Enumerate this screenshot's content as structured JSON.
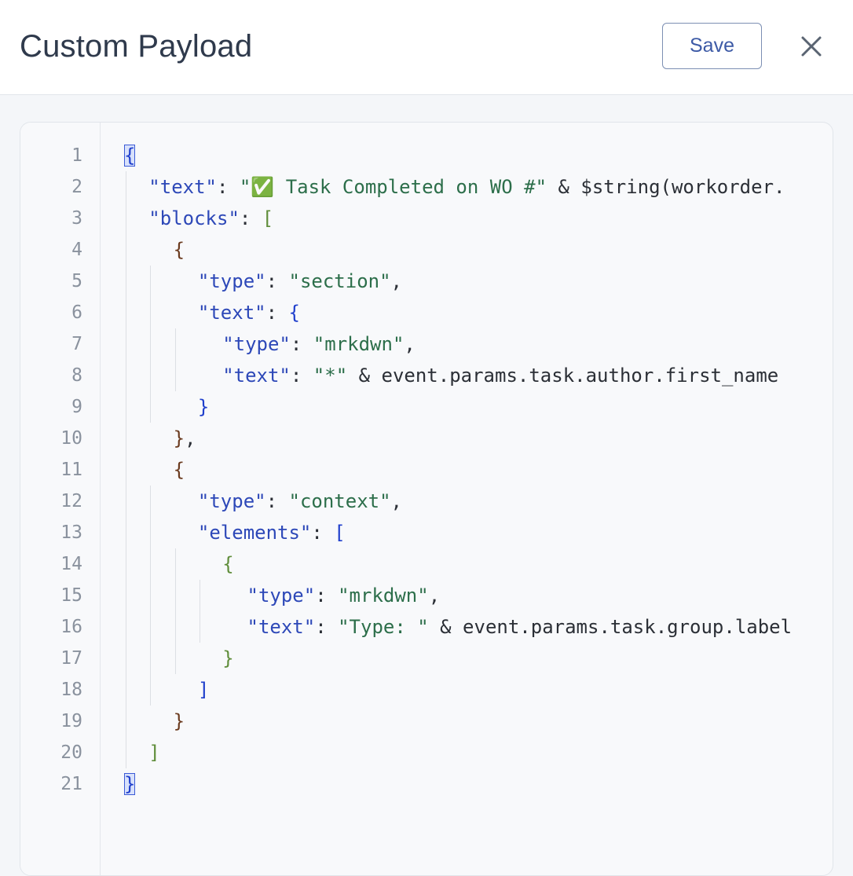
{
  "header": {
    "title": "Custom Payload",
    "save_label": "Save",
    "close_icon": "close-icon"
  },
  "colors": {
    "key": "#2d48b8",
    "string": "#2c6e4a",
    "bracket_blue": "#1f3fcc",
    "bracket_green": "#5f8d3a",
    "bracket_brown": "#6b3b1f",
    "save_text": "#3d5aa6"
  },
  "editor": {
    "line_numbers": [
      "1",
      "2",
      "3",
      "4",
      "5",
      "6",
      "7",
      "8",
      "9",
      "10",
      "11",
      "12",
      "13",
      "14",
      "15",
      "16",
      "17",
      "18",
      "19",
      "20",
      "21"
    ],
    "lines": [
      {
        "segs": [
          {
            "t": "{",
            "c": "b1 match"
          }
        ]
      },
      {
        "segs": [
          {
            "t": "\"text\"",
            "c": "k"
          },
          {
            "t": ": ",
            "c": "p"
          },
          {
            "t": "\"✅ Task Completed on WO #\"",
            "c": "s"
          },
          {
            "t": " & $string(workorder.",
            "c": "p"
          }
        ]
      },
      {
        "segs": [
          {
            "t": "\"blocks\"",
            "c": "k"
          },
          {
            "t": ": ",
            "c": "p"
          },
          {
            "t": "[",
            "c": "b2"
          }
        ]
      },
      {
        "segs": [
          {
            "t": "{",
            "c": "b3"
          }
        ]
      },
      {
        "segs": [
          {
            "t": "\"type\"",
            "c": "k"
          },
          {
            "t": ": ",
            "c": "p"
          },
          {
            "t": "\"section\"",
            "c": "s"
          },
          {
            "t": ",",
            "c": "p"
          }
        ]
      },
      {
        "segs": [
          {
            "t": "\"text\"",
            "c": "k"
          },
          {
            "t": ": ",
            "c": "p"
          },
          {
            "t": "{",
            "c": "b1"
          }
        ]
      },
      {
        "segs": [
          {
            "t": "\"type\"",
            "c": "k"
          },
          {
            "t": ": ",
            "c": "p"
          },
          {
            "t": "\"mrkdwn\"",
            "c": "s"
          },
          {
            "t": ",",
            "c": "p"
          }
        ]
      },
      {
        "segs": [
          {
            "t": "\"text\"",
            "c": "k"
          },
          {
            "t": ": ",
            "c": "p"
          },
          {
            "t": "\"*\"",
            "c": "s"
          },
          {
            "t": " & event.params.task.author.first_name",
            "c": "p"
          }
        ]
      },
      {
        "segs": [
          {
            "t": "}",
            "c": "b1"
          }
        ]
      },
      {
        "segs": [
          {
            "t": "}",
            "c": "b3"
          },
          {
            "t": ",",
            "c": "p"
          }
        ]
      },
      {
        "segs": [
          {
            "t": "{",
            "c": "b3"
          }
        ]
      },
      {
        "segs": [
          {
            "t": "\"type\"",
            "c": "k"
          },
          {
            "t": ": ",
            "c": "p"
          },
          {
            "t": "\"context\"",
            "c": "s"
          },
          {
            "t": ",",
            "c": "p"
          }
        ]
      },
      {
        "segs": [
          {
            "t": "\"elements\"",
            "c": "k"
          },
          {
            "t": ": ",
            "c": "p"
          },
          {
            "t": "[",
            "c": "b1"
          }
        ]
      },
      {
        "segs": [
          {
            "t": "{",
            "c": "b2"
          }
        ]
      },
      {
        "segs": [
          {
            "t": "\"type\"",
            "c": "k"
          },
          {
            "t": ": ",
            "c": "p"
          },
          {
            "t": "\"mrkdwn\"",
            "c": "s"
          },
          {
            "t": ",",
            "c": "p"
          }
        ]
      },
      {
        "segs": [
          {
            "t": "\"text\"",
            "c": "k"
          },
          {
            "t": ": ",
            "c": "p"
          },
          {
            "t": "\"Type: \"",
            "c": "s"
          },
          {
            "t": " & event.params.task.group.label",
            "c": "p"
          }
        ]
      },
      {
        "segs": [
          {
            "t": "}",
            "c": "b2"
          }
        ]
      },
      {
        "segs": [
          {
            "t": "]",
            "c": "b1"
          }
        ]
      },
      {
        "segs": [
          {
            "t": "}",
            "c": "b3"
          }
        ]
      },
      {
        "segs": [
          {
            "t": "]",
            "c": "b2"
          }
        ]
      },
      {
        "segs": [
          {
            "t": "}",
            "c": "b1 match"
          }
        ]
      }
    ]
  }
}
